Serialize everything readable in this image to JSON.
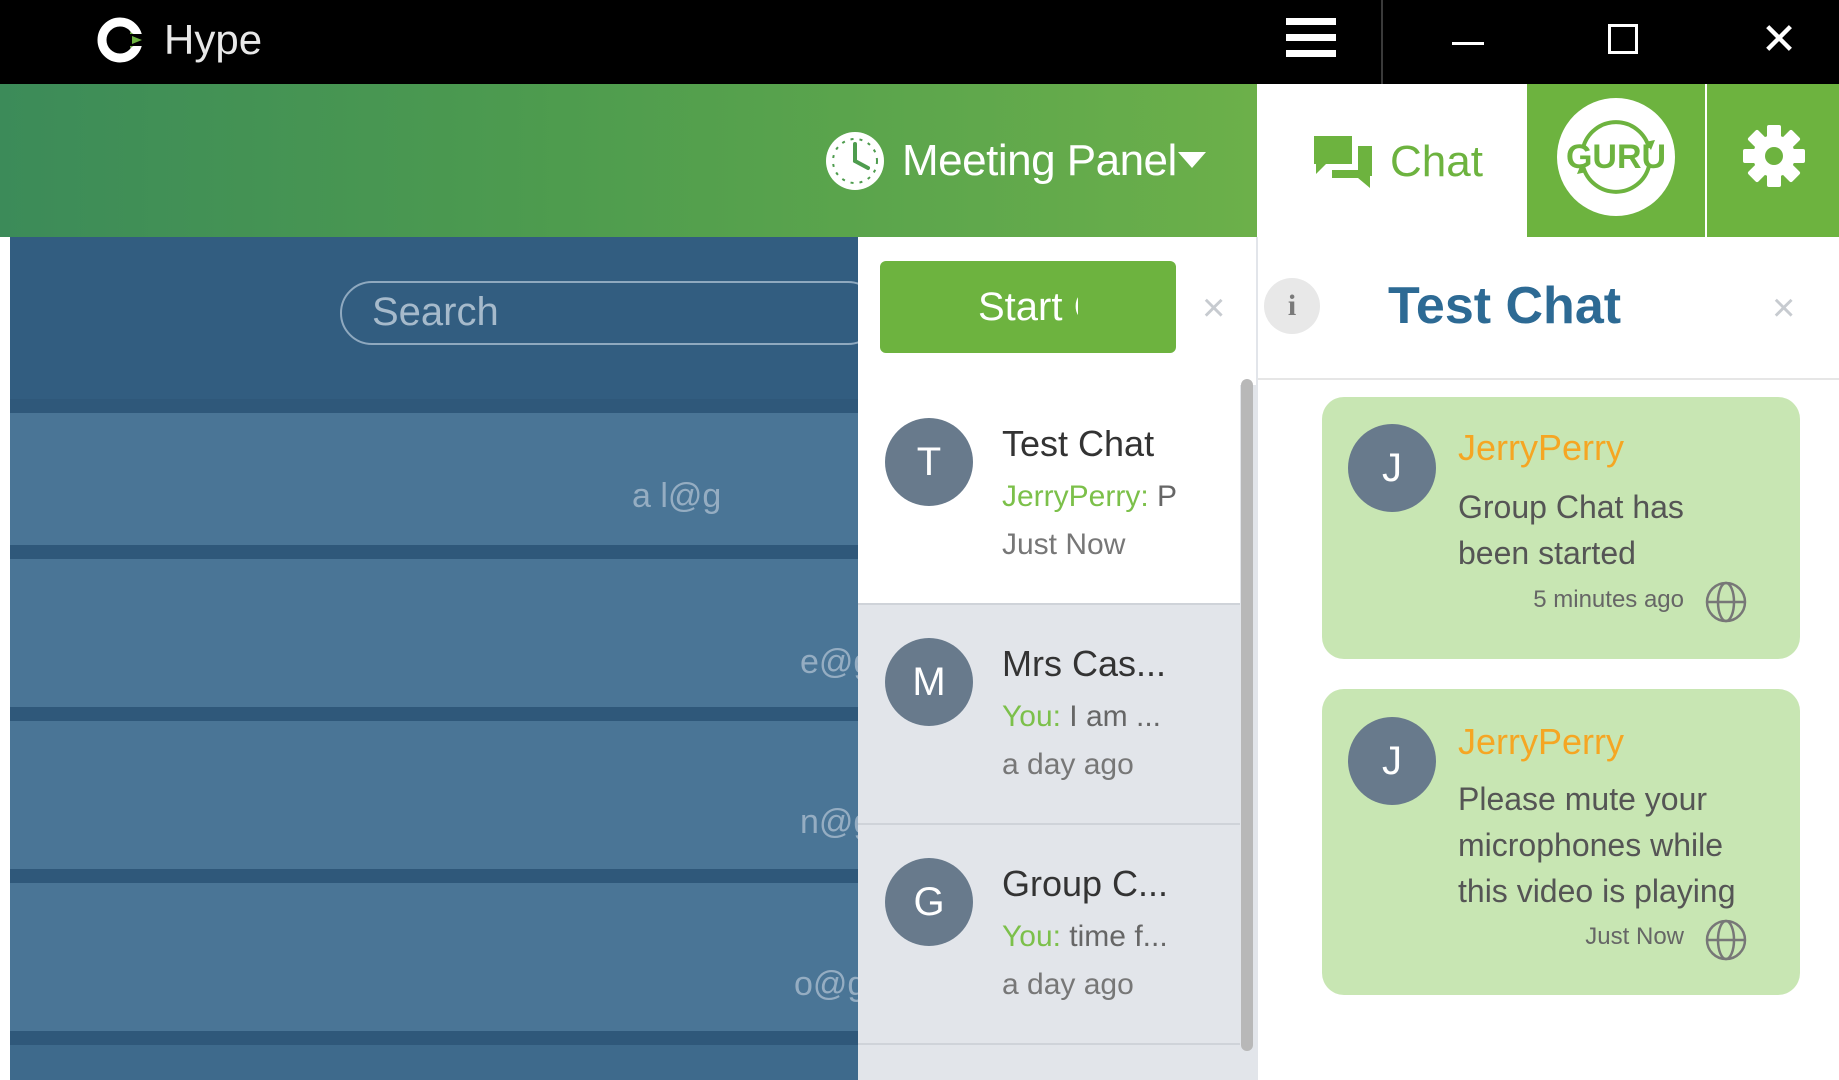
{
  "titlebar": {
    "app_name": "Hype",
    "icons": [
      "hype-logo-icon",
      "hamburger-menu-icon",
      "minimize-icon",
      "maximize-icon",
      "close-icon"
    ]
  },
  "header": {
    "meeting_panel_label": "Meeting Panel",
    "chat_tab_label": "Chat",
    "guru_label": "GURU",
    "icons": [
      "clock-icon",
      "chevron-down-icon",
      "chat-bubbles-icon",
      "gear-icon"
    ]
  },
  "contacts": {
    "search_placeholder": "Search",
    "rows": [
      {
        "email_fragment": "a            l@g"
      },
      {
        "email_fragment": "e@g"
      },
      {
        "email_fragment": "n@g"
      },
      {
        "email_fragment": "o@g"
      }
    ]
  },
  "chat_list": {
    "start_chat_label": "Start Chat",
    "close_symbol": "×",
    "conversations": [
      {
        "avatar": "T",
        "title": "Test Chat",
        "sender": "JerryPerry:",
        "snippet": " P",
        "time": "Just Now",
        "active": true
      },
      {
        "avatar": "M",
        "title": "Mrs Cas...",
        "sender": "You:",
        "snippet": " I am ...",
        "time": "a day ago",
        "active": false
      },
      {
        "avatar": "G",
        "title": "Group C...",
        "sender": "You:",
        "snippet": " time f...",
        "time": "a day ago",
        "active": false
      }
    ]
  },
  "conversation": {
    "title": "Test Chat",
    "info_symbol": "i",
    "close_symbol": "×",
    "messages": [
      {
        "avatar": "J",
        "sender": "JerryPerry",
        "lines": [
          "Group Chat has",
          "been started"
        ],
        "time": "5 minutes ago"
      },
      {
        "avatar": "J",
        "sender": "JerryPerry",
        "lines": [
          "Please mute your",
          "microphones while",
          "this video is playing"
        ],
        "time": "Just Now"
      }
    ]
  },
  "colors": {
    "brand_green": "#6db33f",
    "title_blue": "#2d6a94",
    "sender_orange": "#f5a623",
    "bubble_green": "#c8e6b3",
    "avatar_gray": "#687a8c"
  }
}
